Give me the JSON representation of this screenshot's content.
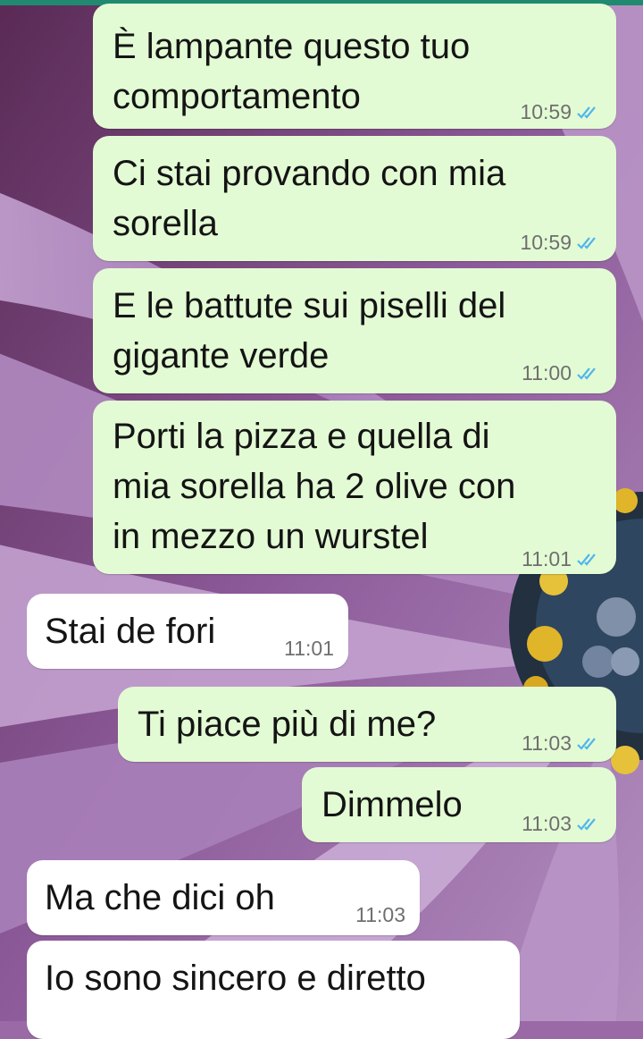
{
  "colors": {
    "outgoing_bubble": "#e3fbd4",
    "incoming_bubble": "#ffffff",
    "read_ticks": "#4fb6ec",
    "header_strip": "#1f8a70"
  },
  "wallpaper": {
    "subject": "purple daisy flower close-up"
  },
  "messages": [
    {
      "dir": "out",
      "text": "È lampante questo tuo\ncomportamento",
      "time": "10:59",
      "status": "read-double-check-icon"
    },
    {
      "dir": "out",
      "text": "Ci stai provando con mia\nsorella",
      "time": "10:59",
      "status": "read-double-check-icon"
    },
    {
      "dir": "out",
      "text": "E le battute sui piselli del\ngigante verde",
      "time": "11:00",
      "status": "read-double-check-icon"
    },
    {
      "dir": "out",
      "text": "Porti la pizza e quella di\nmia sorella ha 2 olive con\nin mezzo un wurstel",
      "time": "11:01",
      "status": "read-double-check-icon"
    },
    {
      "dir": "in",
      "text": "Stai de fori",
      "time": "11:01"
    },
    {
      "dir": "out",
      "text": "Ti piace più di me?",
      "time": "11:03",
      "status": "read-double-check-icon"
    },
    {
      "dir": "out",
      "text": "Dimmelo",
      "time": "11:03",
      "status": "read-double-check-icon"
    },
    {
      "dir": "in",
      "text": "Ma che dici oh",
      "time": "11:03"
    },
    {
      "dir": "in",
      "text": "Io sono sincero e diretto",
      "time": ""
    }
  ]
}
